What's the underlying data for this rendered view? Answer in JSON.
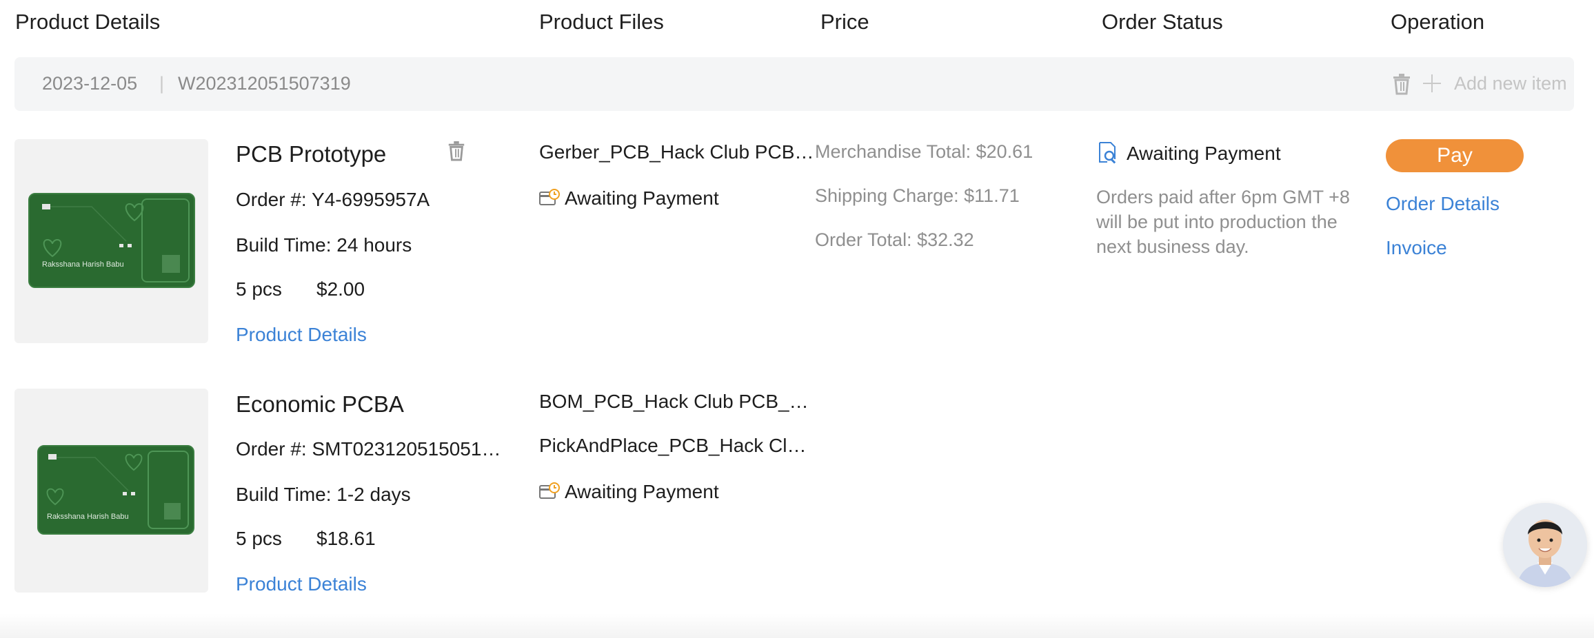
{
  "columns": {
    "product_details": "Product Details",
    "product_files": "Product Files",
    "price": "Price",
    "order_status": "Order Status",
    "operation": "Operation"
  },
  "order": {
    "date": "2023-12-05",
    "separator": "|",
    "number": "W202312051507319",
    "add_new_item": "Add new item",
    "price": {
      "merchandise_total": "Merchandise Total: $20.61",
      "shipping_charge": "Shipping Charge: $11.71",
      "order_total": "Order Total: $32.32"
    },
    "status": {
      "label": "Awaiting Payment",
      "note": [
        "Orders paid after 6pm GMT +8",
        "will be put into production the",
        "next business day."
      ]
    },
    "operation": {
      "pay": "Pay",
      "order_details": "Order Details",
      "invoice": "Invoice"
    }
  },
  "items": [
    {
      "title": "PCB Prototype",
      "order_no": "Order #: Y4-6995957A",
      "build_time": "Build Time: 24 hours",
      "qty": "5 pcs",
      "price": "$2.00",
      "details_link": "Product Details",
      "files": [
        "Gerber_PCB_Hack Club PCB…"
      ],
      "file_status": "Awaiting Payment",
      "board_text": "Raksshana Harish Babu"
    },
    {
      "title": "Economic PCBA",
      "order_no": "Order #: SMT0231205150513…",
      "build_time": "Build Time: 1-2 days",
      "qty": "5 pcs",
      "price": "$18.61",
      "details_link": "Product Details",
      "files": [
        "BOM_PCB_Hack Club PCB_…",
        "PickAndPlace_PCB_Hack Cl…"
      ],
      "file_status": "Awaiting Payment",
      "board_text": "Raksshana Harish Babu"
    }
  ],
  "colors": {
    "accent_link": "#3b82d6",
    "pay_button": "#f0913a",
    "pcb_green": "#2a6a30",
    "status_icon": "#f0a020"
  }
}
